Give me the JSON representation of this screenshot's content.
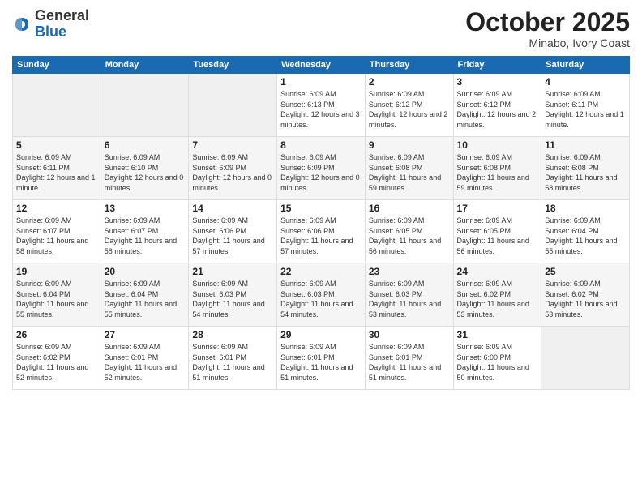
{
  "logo": {
    "general": "General",
    "blue": "Blue"
  },
  "header": {
    "month": "October 2025",
    "location": "Minabo, Ivory Coast"
  },
  "days_of_week": [
    "Sunday",
    "Monday",
    "Tuesday",
    "Wednesday",
    "Thursday",
    "Friday",
    "Saturday"
  ],
  "weeks": [
    [
      {
        "day": "",
        "info": ""
      },
      {
        "day": "",
        "info": ""
      },
      {
        "day": "",
        "info": ""
      },
      {
        "day": "1",
        "info": "Sunrise: 6:09 AM\nSunset: 6:13 PM\nDaylight: 12 hours and 3 minutes."
      },
      {
        "day": "2",
        "info": "Sunrise: 6:09 AM\nSunset: 6:12 PM\nDaylight: 12 hours and 2 minutes."
      },
      {
        "day": "3",
        "info": "Sunrise: 6:09 AM\nSunset: 6:12 PM\nDaylight: 12 hours and 2 minutes."
      },
      {
        "day": "4",
        "info": "Sunrise: 6:09 AM\nSunset: 6:11 PM\nDaylight: 12 hours and 1 minute."
      }
    ],
    [
      {
        "day": "5",
        "info": "Sunrise: 6:09 AM\nSunset: 6:11 PM\nDaylight: 12 hours and 1 minute."
      },
      {
        "day": "6",
        "info": "Sunrise: 6:09 AM\nSunset: 6:10 PM\nDaylight: 12 hours and 0 minutes."
      },
      {
        "day": "7",
        "info": "Sunrise: 6:09 AM\nSunset: 6:09 PM\nDaylight: 12 hours and 0 minutes."
      },
      {
        "day": "8",
        "info": "Sunrise: 6:09 AM\nSunset: 6:09 PM\nDaylight: 12 hours and 0 minutes."
      },
      {
        "day": "9",
        "info": "Sunrise: 6:09 AM\nSunset: 6:08 PM\nDaylight: 11 hours and 59 minutes."
      },
      {
        "day": "10",
        "info": "Sunrise: 6:09 AM\nSunset: 6:08 PM\nDaylight: 11 hours and 59 minutes."
      },
      {
        "day": "11",
        "info": "Sunrise: 6:09 AM\nSunset: 6:08 PM\nDaylight: 11 hours and 58 minutes."
      }
    ],
    [
      {
        "day": "12",
        "info": "Sunrise: 6:09 AM\nSunset: 6:07 PM\nDaylight: 11 hours and 58 minutes."
      },
      {
        "day": "13",
        "info": "Sunrise: 6:09 AM\nSunset: 6:07 PM\nDaylight: 11 hours and 58 minutes."
      },
      {
        "day": "14",
        "info": "Sunrise: 6:09 AM\nSunset: 6:06 PM\nDaylight: 11 hours and 57 minutes."
      },
      {
        "day": "15",
        "info": "Sunrise: 6:09 AM\nSunset: 6:06 PM\nDaylight: 11 hours and 57 minutes."
      },
      {
        "day": "16",
        "info": "Sunrise: 6:09 AM\nSunset: 6:05 PM\nDaylight: 11 hours and 56 minutes."
      },
      {
        "day": "17",
        "info": "Sunrise: 6:09 AM\nSunset: 6:05 PM\nDaylight: 11 hours and 56 minutes."
      },
      {
        "day": "18",
        "info": "Sunrise: 6:09 AM\nSunset: 6:04 PM\nDaylight: 11 hours and 55 minutes."
      }
    ],
    [
      {
        "day": "19",
        "info": "Sunrise: 6:09 AM\nSunset: 6:04 PM\nDaylight: 11 hours and 55 minutes."
      },
      {
        "day": "20",
        "info": "Sunrise: 6:09 AM\nSunset: 6:04 PM\nDaylight: 11 hours and 55 minutes."
      },
      {
        "day": "21",
        "info": "Sunrise: 6:09 AM\nSunset: 6:03 PM\nDaylight: 11 hours and 54 minutes."
      },
      {
        "day": "22",
        "info": "Sunrise: 6:09 AM\nSunset: 6:03 PM\nDaylight: 11 hours and 54 minutes."
      },
      {
        "day": "23",
        "info": "Sunrise: 6:09 AM\nSunset: 6:03 PM\nDaylight: 11 hours and 53 minutes."
      },
      {
        "day": "24",
        "info": "Sunrise: 6:09 AM\nSunset: 6:02 PM\nDaylight: 11 hours and 53 minutes."
      },
      {
        "day": "25",
        "info": "Sunrise: 6:09 AM\nSunset: 6:02 PM\nDaylight: 11 hours and 53 minutes."
      }
    ],
    [
      {
        "day": "26",
        "info": "Sunrise: 6:09 AM\nSunset: 6:02 PM\nDaylight: 11 hours and 52 minutes."
      },
      {
        "day": "27",
        "info": "Sunrise: 6:09 AM\nSunset: 6:01 PM\nDaylight: 11 hours and 52 minutes."
      },
      {
        "day": "28",
        "info": "Sunrise: 6:09 AM\nSunset: 6:01 PM\nDaylight: 11 hours and 51 minutes."
      },
      {
        "day": "29",
        "info": "Sunrise: 6:09 AM\nSunset: 6:01 PM\nDaylight: 11 hours and 51 minutes."
      },
      {
        "day": "30",
        "info": "Sunrise: 6:09 AM\nSunset: 6:01 PM\nDaylight: 11 hours and 51 minutes."
      },
      {
        "day": "31",
        "info": "Sunrise: 6:09 AM\nSunset: 6:00 PM\nDaylight: 11 hours and 50 minutes."
      },
      {
        "day": "",
        "info": ""
      }
    ]
  ]
}
